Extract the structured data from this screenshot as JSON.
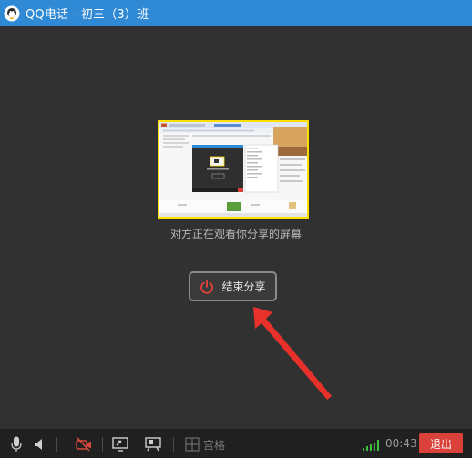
{
  "window": {
    "title": "QQ电话 - 初三（3）班",
    "accent_color": "#2f89d4"
  },
  "main": {
    "sharing_status": "对方正在观看你分享的屏幕",
    "end_share_label": "结束分享",
    "end_share_icon": "power-icon",
    "preview_border_color": "#ffde00",
    "annotation_arrow_color": "#e8312a"
  },
  "toolbar": {
    "icons": [
      "microphone-icon",
      "speaker-icon",
      "camera-off-icon",
      "screen-share-icon",
      "whiteboard-icon",
      "grid-icon"
    ],
    "grid_label": "宫格",
    "timer": "00:43",
    "exit_label": "退出",
    "exit_color": "#d9413a",
    "signal_icon": "signal-strength-icon"
  }
}
